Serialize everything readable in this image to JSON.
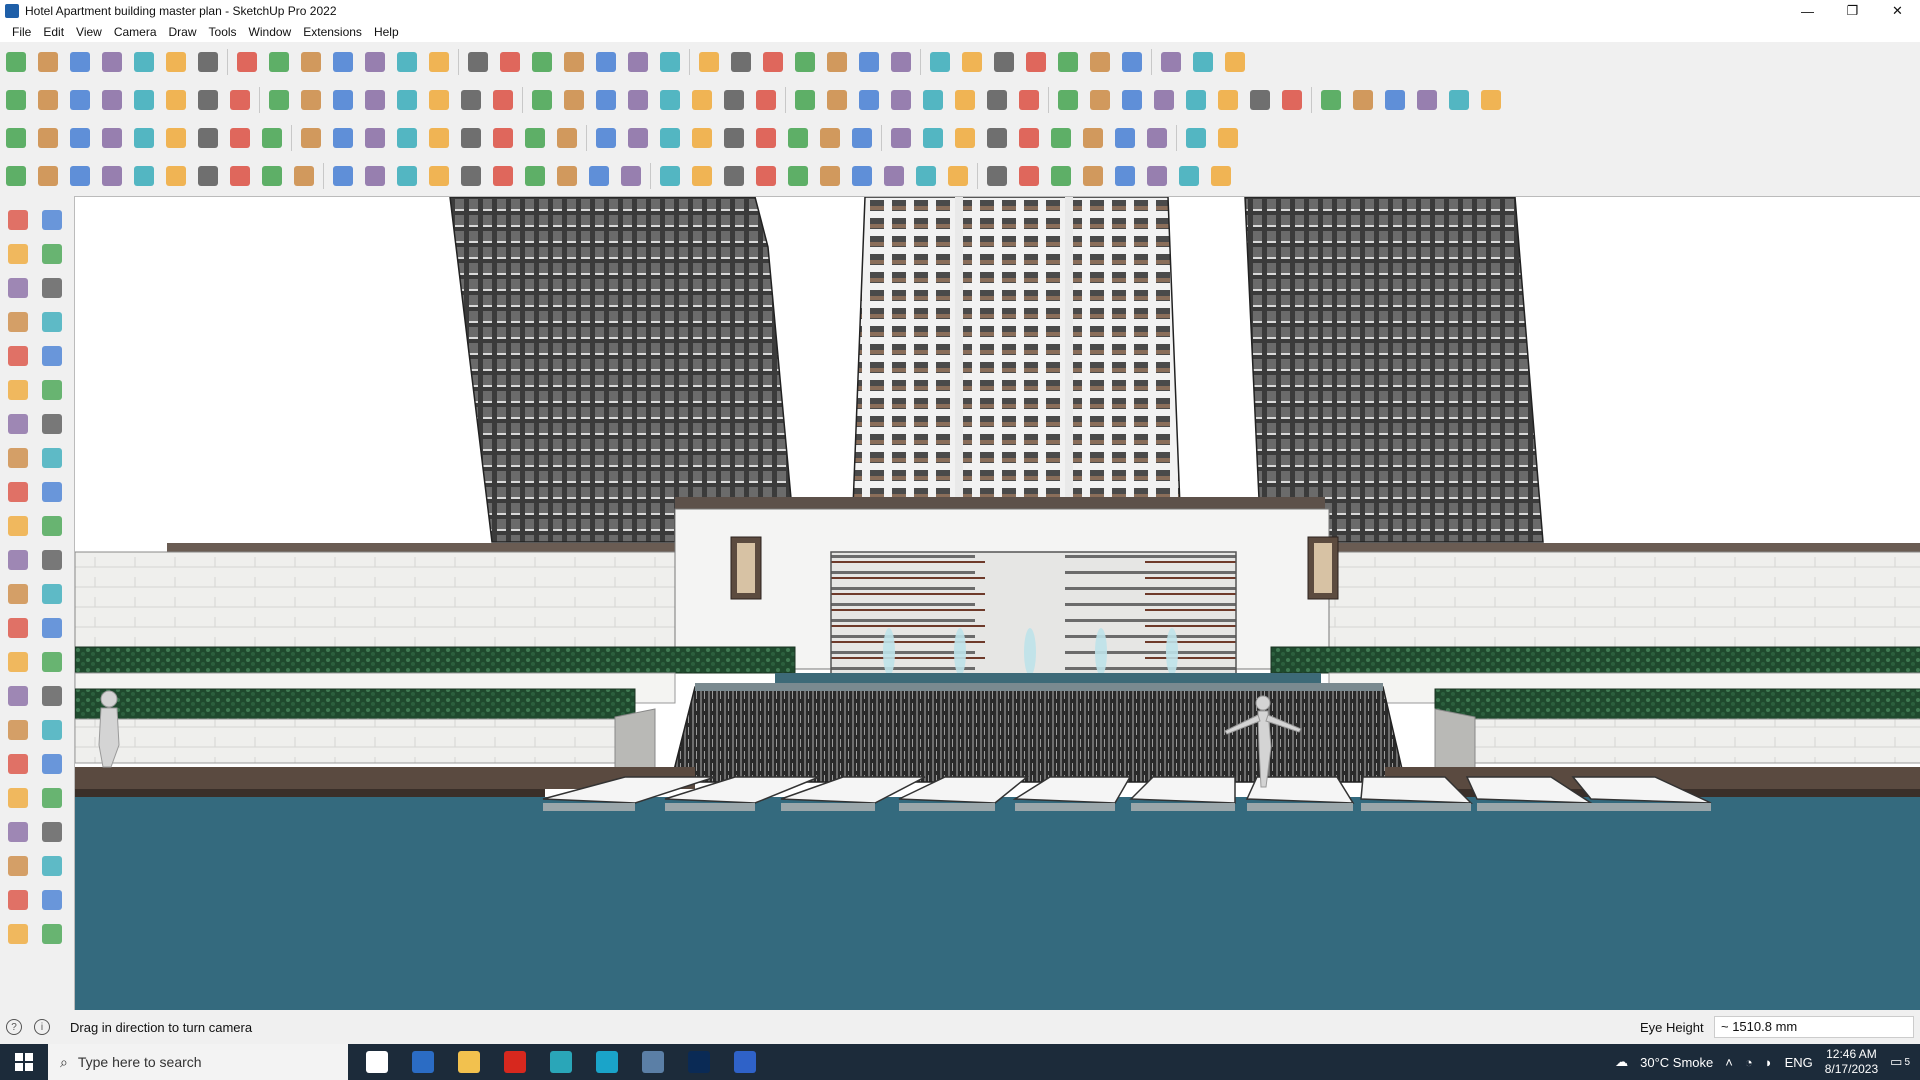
{
  "window": {
    "title": "Hotel Apartment building master plan - SketchUp Pro 2022",
    "controls": [
      "—",
      "❐",
      "✕"
    ]
  },
  "menu": [
    "File",
    "Edit",
    "View",
    "Camera",
    "Draw",
    "Tools",
    "Window",
    "Extensions",
    "Help"
  ],
  "toolbar_colors": [
    "#d93a2b",
    "#2f6fd0",
    "#f0a020",
    "#2e9a3a",
    "#7a5a9a",
    "#444444",
    "#c77c2c",
    "#1fa3b3"
  ],
  "status": {
    "message": "Drag in direction to turn camera",
    "measure_label": "Eye Height",
    "measure_value": "~ 1510.8 mm"
  },
  "taskbar": {
    "search_placeholder": "Type here to search",
    "weather": "30°C  Smoke",
    "language": "ENG",
    "time": "12:46 AM",
    "date": "8/17/2023",
    "notification_count": "5",
    "apps": [
      {
        "name": "task-view-icon",
        "color": "#ffffff"
      },
      {
        "name": "calculator-icon",
        "color": "#2b6cc4"
      },
      {
        "name": "file-explorer-icon",
        "color": "#f2c14e"
      },
      {
        "name": "acrobat-icon",
        "color": "#d7281e"
      },
      {
        "name": "sketchup-layout-icon",
        "color": "#2aa6b8"
      },
      {
        "name": "edge-icon",
        "color": "#1aa4c9"
      },
      {
        "name": "snipping-tool-icon",
        "color": "#5b7fa6"
      },
      {
        "name": "photoshop-icon",
        "color": "#0a2a55"
      },
      {
        "name": "sketchup-icon",
        "color": "#2f62c8"
      }
    ]
  }
}
